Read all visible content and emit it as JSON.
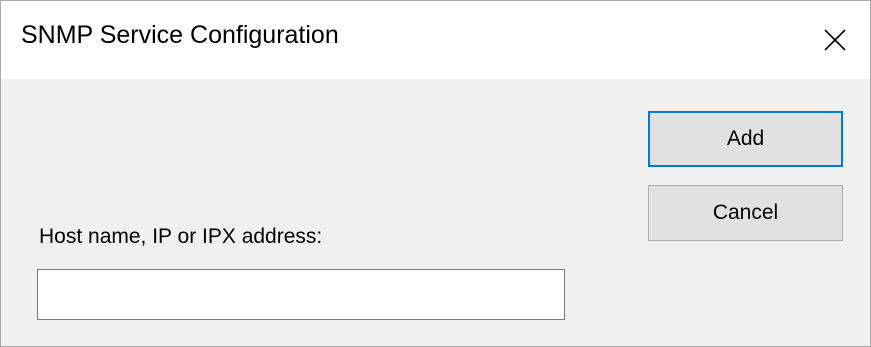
{
  "window": {
    "title": "SNMP Service Configuration",
    "close_icon": "close-icon"
  },
  "form": {
    "host_label": "Host name, IP or IPX address:",
    "host_value": "",
    "host_placeholder": ""
  },
  "buttons": {
    "add_label": "Add",
    "cancel_label": "Cancel"
  },
  "colors": {
    "focus_accent": "#0078d7",
    "dialog_background": "#f0f0f0",
    "button_face": "#e1e1e1"
  }
}
